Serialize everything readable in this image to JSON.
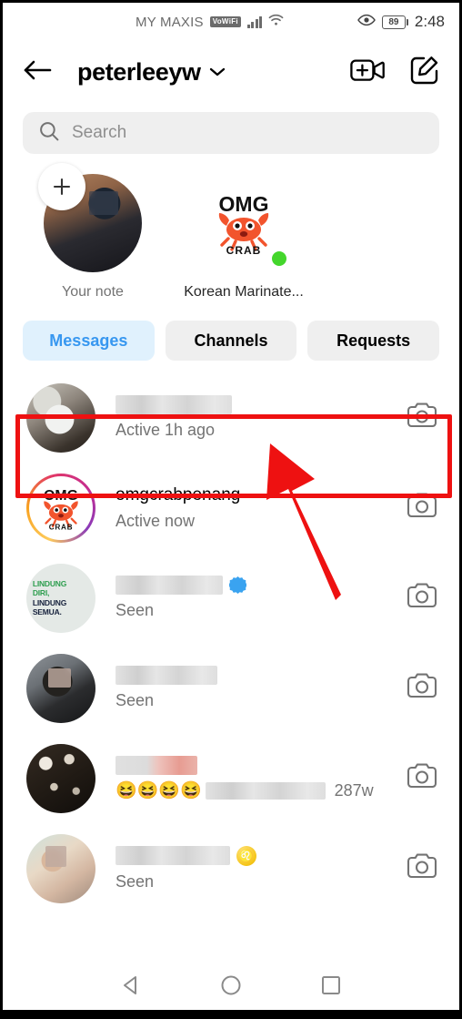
{
  "status_bar": {
    "carrier": "MY MAXIS",
    "network_badge": "VoWiFi",
    "signal_icon": "signal-bars-icon",
    "wifi_icon": "wifi-icon",
    "eye_icon": "eye-icon",
    "battery_level": "89",
    "time": "2:48"
  },
  "header": {
    "back_icon": "back-arrow-icon",
    "username": "peterleeyw",
    "caret_icon": "chevron-down-icon",
    "video_call_icon": "new-video-call-icon",
    "new_message_icon": "new-message-icon"
  },
  "search": {
    "icon": "search-icon",
    "placeholder": "Search",
    "value": ""
  },
  "notes": [
    {
      "label": "Your note",
      "avatar": "own-profile-photo",
      "add_icon": "plus-icon",
      "has_add_bubble": true,
      "online": false,
      "ring": false
    },
    {
      "label": "Korean Marinate...",
      "avatar": "omg-crab-logo",
      "has_add_bubble": false,
      "online": true,
      "ring": false
    }
  ],
  "tabs": [
    {
      "label": "Messages",
      "active": true
    },
    {
      "label": "Channels",
      "active": false
    },
    {
      "label": "Requests",
      "active": false
    }
  ],
  "chats": [
    {
      "avatar": "cat-photo",
      "name": "",
      "name_blurred": true,
      "name_blur_width": 128,
      "subtitle": "Active 1h ago",
      "time": "",
      "ring": false,
      "badge": "",
      "emoji": "",
      "camera_icon": "camera-icon",
      "highlighted": true
    },
    {
      "avatar": "omg-crab-logo",
      "name": "omgcrabpenang",
      "name_blurred": false,
      "name_blur_width": 0,
      "subtitle": "Active now",
      "time": "",
      "ring": true,
      "badge": "",
      "emoji": "",
      "camera_icon": "camera-icon",
      "highlighted": false
    },
    {
      "avatar": "lindung-diri-poster",
      "name": "",
      "name_blurred": true,
      "name_blur_width": 118,
      "subtitle": "Seen",
      "time": "",
      "ring": false,
      "badge": "blue-verified-badge",
      "emoji": "",
      "camera_icon": "camera-icon",
      "highlighted": false
    },
    {
      "avatar": "person-dark-photo",
      "name": "",
      "name_blurred": true,
      "name_blur_width": 112,
      "subtitle": "Seen",
      "time": "",
      "ring": false,
      "badge": "",
      "emoji": "",
      "camera_icon": "camera-icon",
      "highlighted": false
    },
    {
      "avatar": "flowers-dark-photo",
      "name": "",
      "name_blurred": true,
      "name_blur_width": 90,
      "name_blur_style": "pink",
      "subtitle": "",
      "subtitle_blurred": true,
      "subtitle_blur_width": 132,
      "emoji": "😆😆😆😆",
      "time": "287w",
      "ring": false,
      "badge": "",
      "camera_icon": "camera-icon",
      "highlighted": false
    },
    {
      "avatar": "group-photo",
      "name": "",
      "name_blurred": true,
      "name_blur_width": 126,
      "subtitle": "Seen",
      "time": "",
      "ring": false,
      "badge": "",
      "emoji": "♌",
      "zodiac": true,
      "camera_icon": "camera-icon",
      "highlighted": false
    }
  ],
  "annotations": {
    "highlight_color": "#ee1111",
    "arrow_color": "#ee1111",
    "arrow_direction": "up-left",
    "target": "first-chat-row"
  },
  "nav_bar": {
    "back_icon": "android-back-icon",
    "home_icon": "android-home-icon",
    "recents_icon": "android-recents-icon"
  },
  "theme": {
    "accent": "#3797f0",
    "tab_active_bg": "#e0f1fd",
    "muted_text": "#737373",
    "field_bg": "#efefef",
    "online_green": "#44d62c"
  }
}
